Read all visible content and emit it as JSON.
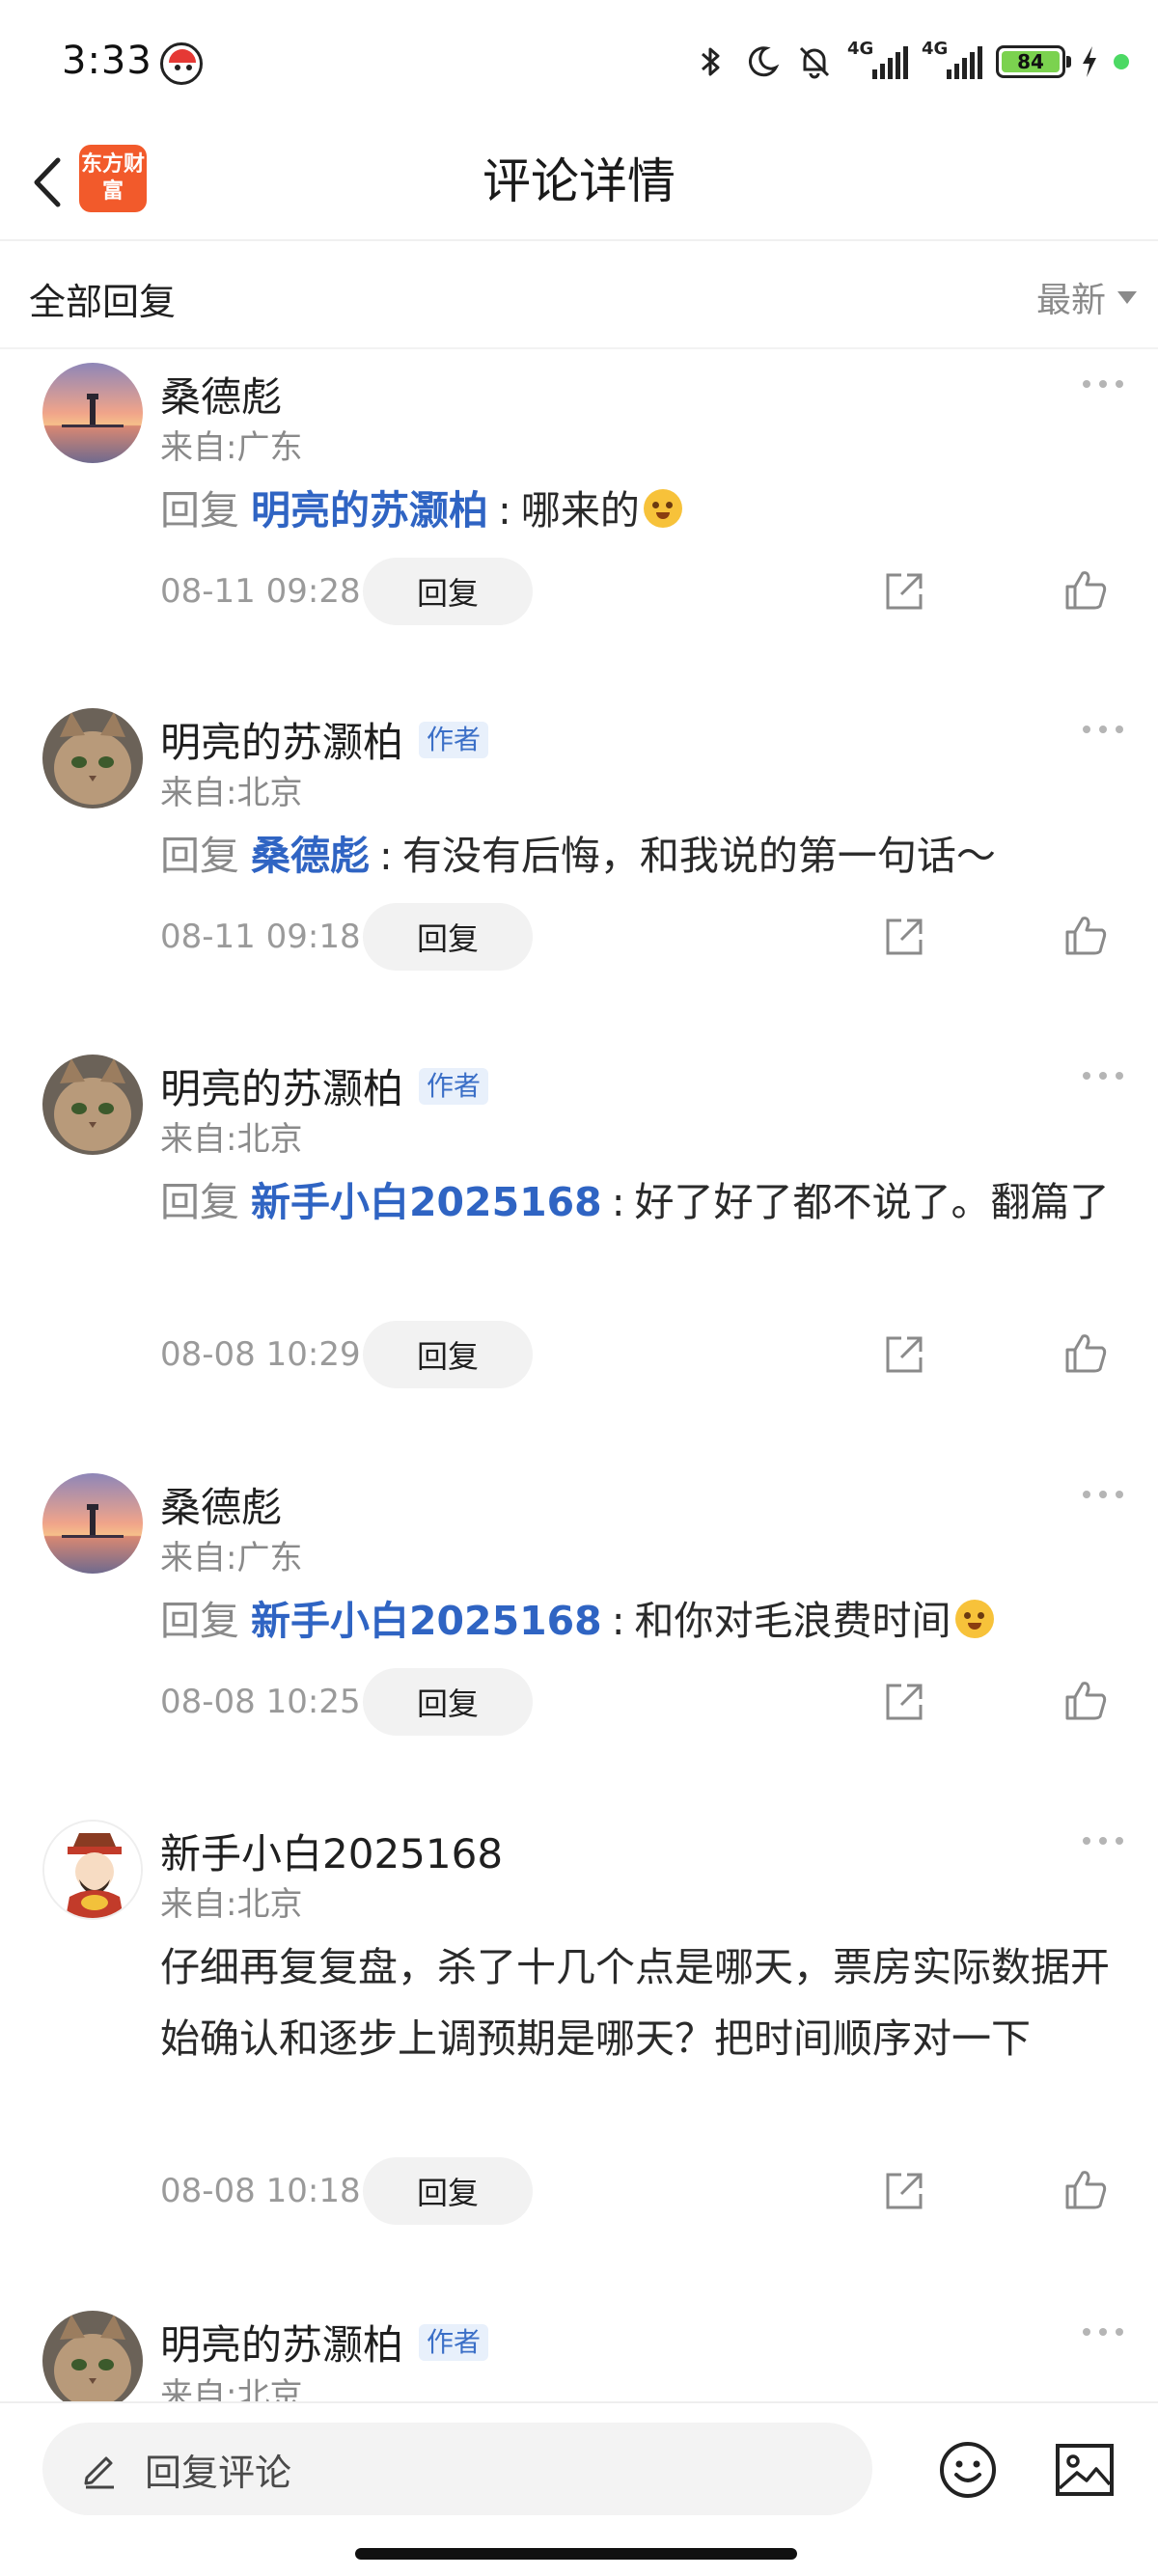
{
  "status_bar": {
    "time": "3:33",
    "network_1": "4G",
    "network_2": "4G",
    "battery_level": "84",
    "icons": [
      "app-notification-icon",
      "bluetooth-icon",
      "moon-icon",
      "mute-icon",
      "signal-icon",
      "battery-icon",
      "charging-icon"
    ]
  },
  "nav": {
    "title": "评论详情",
    "logo_text": "东方财富",
    "logo_color": "#f25a2b"
  },
  "filter": {
    "label": "全部回复",
    "sort": "最新"
  },
  "comments": [
    {
      "name": "桑德彪",
      "author_tag": "",
      "location": "来自:广东",
      "reply_word": "回复",
      "mention": "明亮的苏灏柏",
      "colon": ":",
      "text": "哪来的",
      "time": "08-11 09:28",
      "reply_label": "回复"
    },
    {
      "name": "明亮的苏灏柏",
      "author_tag": "作者",
      "location": "来自:北京",
      "reply_word": "回复",
      "mention": "桑德彪",
      "colon": ":",
      "text": "有没有后悔，和我说的第一句话～",
      "time": "08-11 09:18",
      "reply_label": "回复"
    },
    {
      "name": "明亮的苏灏柏",
      "author_tag": "作者",
      "location": "来自:北京",
      "reply_word": "回复",
      "mention": "新手小白2025168",
      "colon": ":",
      "text": "好了好了都不说了。翻篇了",
      "time": "08-08 10:29",
      "reply_label": "回复"
    },
    {
      "name": "桑德彪",
      "author_tag": "",
      "location": "来自:广东",
      "reply_word": "回复",
      "mention": "新手小白2025168",
      "colon": ":",
      "text": "和你对毛浪费时间",
      "time": "08-08 10:25",
      "reply_label": "回复"
    },
    {
      "name": "新手小白2025168",
      "author_tag": "",
      "location": "来自:北京",
      "text": "仔细再复复盘，杀了十几个点是哪天，票房实际数据开始确认和逐步上调预期是哪天？把时间顺序对一下",
      "time": "08-08 10:18",
      "reply_label": "回复"
    },
    {
      "name": "明亮的苏灏柏",
      "author_tag": "作者",
      "location": "来自:北京"
    }
  ],
  "bottom": {
    "input_placeholder": "回复评论"
  },
  "colors": {
    "mention": "#2f64c3",
    "author_tag_bg": "#e8f0fb",
    "battery_fill": "#7bd24f"
  }
}
